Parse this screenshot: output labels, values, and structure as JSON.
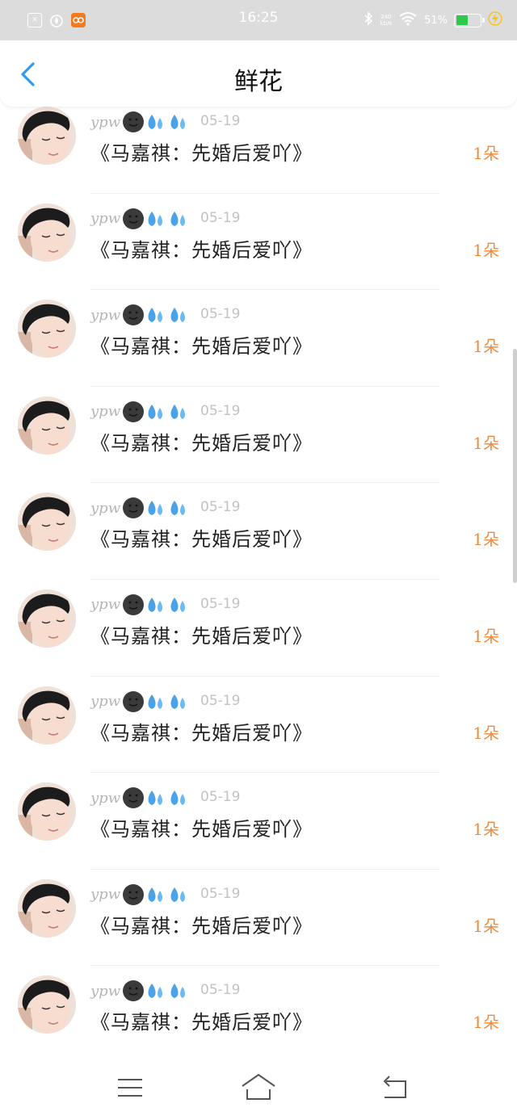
{
  "status_bar": {
    "time": "16:25",
    "net_speed_value": "240",
    "net_speed_unit": "kb/s",
    "battery_percent": "51%",
    "battery_level": 0.51
  },
  "header": {
    "title": "鲜花"
  },
  "items": [
    {
      "username": "ypw",
      "date": "05-19",
      "gift": "《马嘉祺：先婚后爱吖》",
      "count": "1朵"
    },
    {
      "username": "ypw",
      "date": "05-19",
      "gift": "《马嘉祺：先婚后爱吖》",
      "count": "1朵"
    },
    {
      "username": "ypw",
      "date": "05-19",
      "gift": "《马嘉祺：先婚后爱吖》",
      "count": "1朵"
    },
    {
      "username": "ypw",
      "date": "05-19",
      "gift": "《马嘉祺：先婚后爱吖》",
      "count": "1朵"
    },
    {
      "username": "ypw",
      "date": "05-19",
      "gift": "《马嘉祺：先婚后爱吖》",
      "count": "1朵"
    },
    {
      "username": "ypw",
      "date": "05-19",
      "gift": "《马嘉祺：先婚后爱吖》",
      "count": "1朵"
    },
    {
      "username": "ypw",
      "date": "05-19",
      "gift": "《马嘉祺：先婚后爱吖》",
      "count": "1朵"
    },
    {
      "username": "ypw",
      "date": "05-19",
      "gift": "《马嘉祺：先婚后爱吖》",
      "count": "1朵"
    },
    {
      "username": "ypw",
      "date": "05-19",
      "gift": "《马嘉祺：先婚后爱吖》",
      "count": "1朵"
    },
    {
      "username": "ypw",
      "date": "05-19",
      "gift": "《马嘉祺：先婚后爱吖》",
      "count": "1朵"
    }
  ],
  "icons": {
    "back": "chevron-left-icon",
    "menu": "menu-icon",
    "home": "home-icon",
    "return": "return-icon"
  },
  "colors": {
    "accent_blue": "#2f9bf0",
    "count_orange": "#f08a3c",
    "status_bar_bg": "#dcdcdc"
  }
}
